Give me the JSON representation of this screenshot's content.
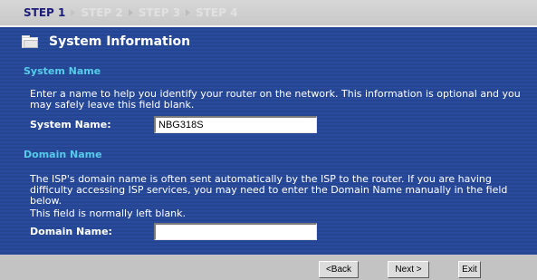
{
  "steps": [
    {
      "label": "STEP 1",
      "active": true
    },
    {
      "label": "STEP 2",
      "active": false
    },
    {
      "label": "STEP 3",
      "active": false
    },
    {
      "label": "STEP 4",
      "active": false
    }
  ],
  "page": {
    "title": "System Information",
    "icon": "folder-icon"
  },
  "system_name_section": {
    "heading": "System Name",
    "description": "Enter a name to help you identify your router on the network. This information is optional and you may safely leave this field blank.",
    "field_label": "System Name:",
    "field_value": "NBG318S"
  },
  "domain_name_section": {
    "heading": "Domain Name",
    "description_line1": "The ISP's domain name is often sent automatically by the ISP to the router. If you are having difficulty accessing ISP services, you may need to enter the Domain Name manually in the field below.",
    "description_line2": "This field is normally left blank.",
    "field_label": "Domain Name:",
    "field_value": ""
  },
  "buttons": {
    "back": "<Back",
    "next": "Next >",
    "exit": "Exit"
  },
  "colors": {
    "panel_bg": "#24458f",
    "section_heading": "#56cbea",
    "step_active": "#1d1d7a",
    "step_inactive": "#e1e1e1",
    "bar_bg": "#c3c3c3"
  }
}
